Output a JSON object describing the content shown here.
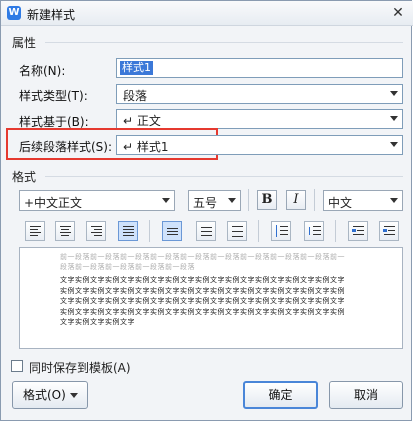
{
  "title": "新建样式",
  "app_icon": "W",
  "sections": {
    "properties": "属性",
    "format": "格式"
  },
  "fields": {
    "name_label": "名称(N):",
    "name_value": "样式1",
    "type_label": "样式类型(T):",
    "type_value": "段落",
    "based_label": "样式基于(B):",
    "based_value": "↵ 正文",
    "next_label": "后续段落样式(S):",
    "next_value": "↵ 样式1"
  },
  "format": {
    "font": "+中文正文",
    "size": "五号",
    "bold": "B",
    "italic": "I",
    "script": "中文"
  },
  "preview": {
    "previous_para": "前一段落前一段落前一段落前一段落前一段落前一段落前一段落前一段落前一段落前一段落前一段落前一段落前一段落前一段落",
    "sample_text": "文字实例文字实例文字实例文字实例文字实例文字实例文字实例文字实例文字实例文字实例文字实例文字实例文字实例文字实例文字实例文字实例文字实例文字实例文字实例文字实例文字实例文字实例文字实例文字实例文字实例文字实例文字实例文字实例文字实例文字实例文字实例文字实例文字实例文字实例文字实例文字实例文字实例文字实例文字实例文字实例文字"
  },
  "add_to_template": "同时保存到模板(A)",
  "buttons": {
    "format": "格式(O)",
    "ok": "确定",
    "cancel": "取消"
  },
  "colors": {
    "accent": "#3b78d8",
    "highlight": "#e5392f"
  },
  "icons": [
    "wps-app-icon",
    "close-icon",
    "align-left-icon",
    "align-center-icon",
    "align-right-icon",
    "justify-icon",
    "single-spacing-icon",
    "one-half-spacing-icon",
    "double-spacing-icon",
    "increase-para-spacing-icon",
    "decrease-para-spacing-icon",
    "decrease-indent-icon",
    "increase-indent-icon"
  ]
}
